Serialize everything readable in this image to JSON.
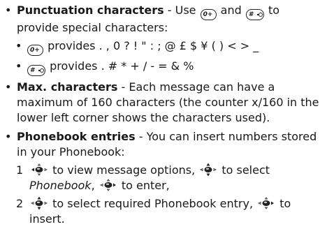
{
  "punctuation": {
    "title": "Punctuation characters",
    "text_a": " - Use ",
    "key0": "0+",
    "text_b": " and ",
    "key_hash": "#",
    "text_c": " to provide special characters:",
    "sub1_text": " provides . , 0 ? ! \" : ; @ £ $ ¥ ( ) < > _",
    "sub2_text": " provides . # * + / - = & %"
  },
  "max_chars": {
    "title": "Max. characters",
    "text": " - Each message can have a maximum of 160 characters (the counter x/160 in the lower left corner shows the characters used)."
  },
  "phonebook": {
    "title": "Phonebook entries",
    "text": " - You can insert numbers stored in your Phonebook:",
    "step1_num": "1",
    "step1_a": " to view message options, ",
    "step1_b": " to select ",
    "step1_italic": "Phonebook",
    "step1_c": ", ",
    "step1_d": " to enter,",
    "step2_num": "2",
    "step2_a": " to select required Phonebook entry, ",
    "step2_b": " to insert."
  },
  "icons": [
    "key-0-icon",
    "key-hash-icon",
    "joystick-left-icon",
    "joystick-up-down-icon",
    "joystick-right-icon"
  ]
}
